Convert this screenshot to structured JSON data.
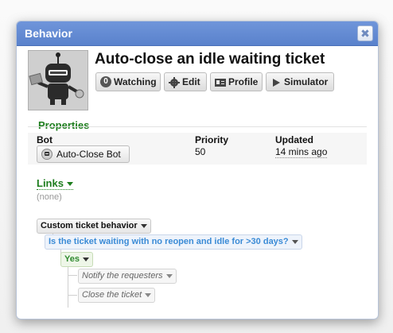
{
  "dialog": {
    "title": "Behavior",
    "close_glyph": "✖"
  },
  "behavior": {
    "name": "Auto-close an idle waiting ticket",
    "avatar_icon": "robot-icon"
  },
  "toolbar": {
    "watching_count": "0",
    "watching_label": "Watching",
    "edit_label": "Edit",
    "profile_label": "Profile",
    "simulator_label": "Simulator"
  },
  "properties": {
    "heading": "Properties",
    "bot_label": "Bot",
    "bot_value": "Auto-Close Bot",
    "priority_label": "Priority",
    "priority_value": "50",
    "updated_label": "Updated",
    "updated_value": "14 mins ago"
  },
  "links": {
    "heading": "Links",
    "empty_text": "(none)"
  },
  "decision_tree": {
    "root": "Custom ticket behavior",
    "condition": "Is the ticket waiting with no reopen and idle for >30 days?",
    "outcome": "Yes",
    "actions": [
      "Notify the requesters",
      "Close the ticket"
    ]
  },
  "colors": {
    "titlebar": "#6189d2",
    "section_heading": "#1d7d1d",
    "condition_text": "#3a8bd6"
  }
}
